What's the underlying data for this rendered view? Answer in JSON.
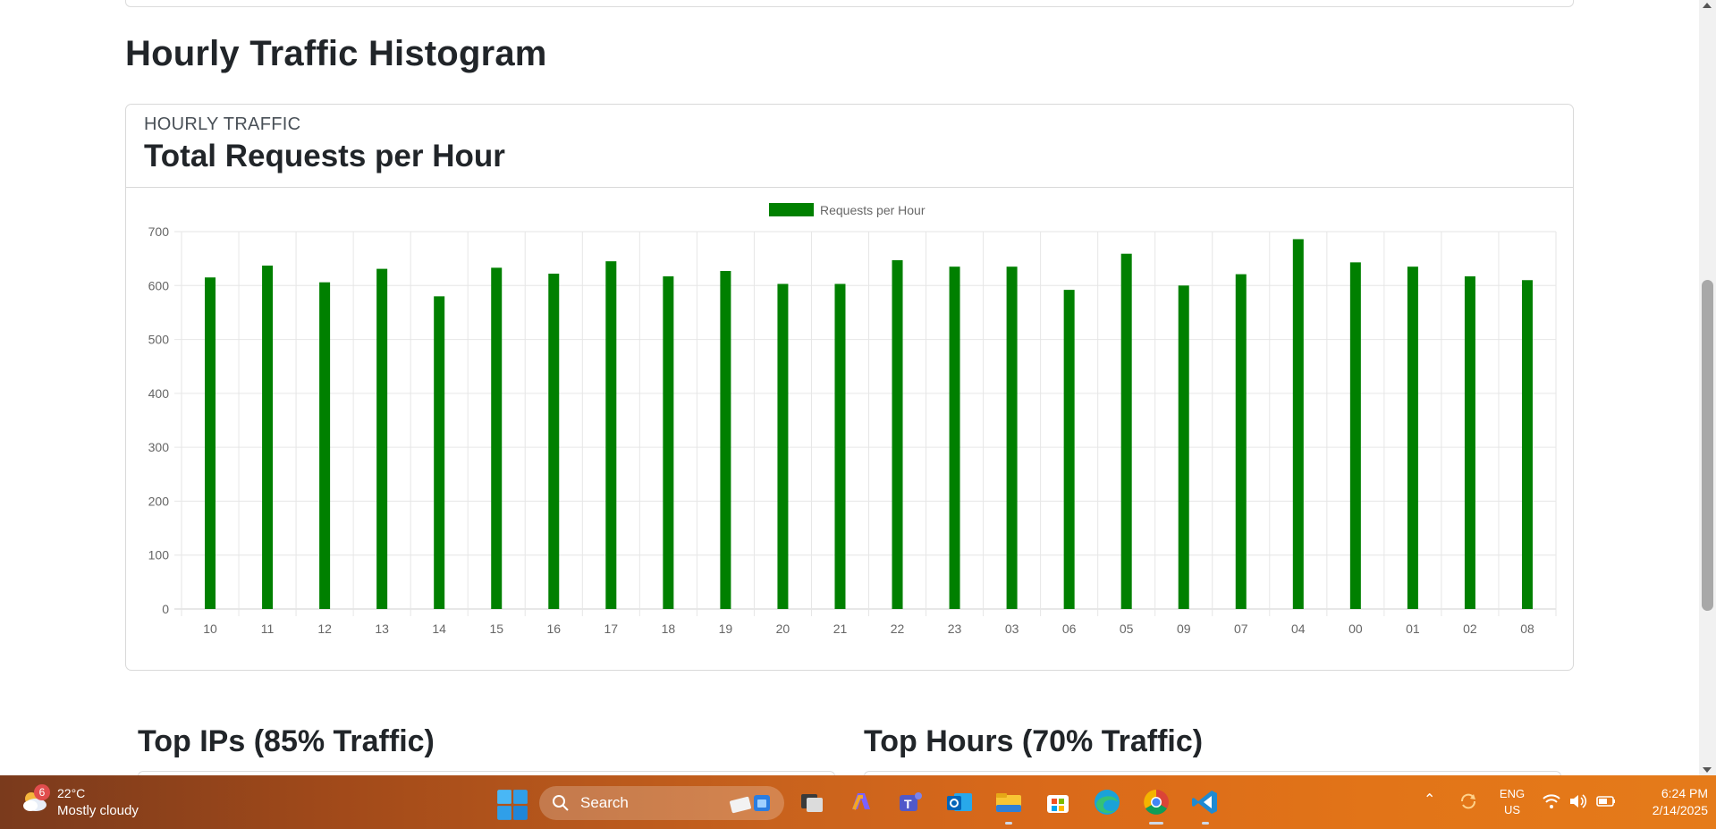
{
  "page": {
    "section_title": "Hourly Traffic Histogram",
    "card_subtitle": "HOURLY TRAFFIC",
    "card_title": "Total Requests per Hour",
    "bottom_left_title": "Top IPs (85% Traffic)",
    "bottom_right_title": "Top Hours (70% Traffic)"
  },
  "chart_data": {
    "type": "bar",
    "categories": [
      "10",
      "11",
      "12",
      "13",
      "14",
      "15",
      "16",
      "17",
      "18",
      "19",
      "20",
      "21",
      "22",
      "23",
      "03",
      "06",
      "05",
      "09",
      "07",
      "04",
      "00",
      "01",
      "02",
      "08"
    ],
    "series": [
      {
        "name": "Requests per Hour",
        "color": "#008000",
        "values": [
          615,
          637,
          606,
          631,
          580,
          633,
          622,
          645,
          617,
          627,
          603,
          603,
          647,
          635,
          635,
          592,
          659,
          600,
          621,
          686,
          643,
          635,
          617,
          610
        ]
      }
    ],
    "ylim": [
      0,
      700
    ],
    "yticks": [
      0,
      100,
      200,
      300,
      400,
      500,
      600,
      700
    ],
    "grid": true,
    "legend": "top-center"
  },
  "taskbar": {
    "weather": {
      "badge": "6",
      "temp": "22°C",
      "desc": "Mostly cloudy"
    },
    "search_label": "Search",
    "language": {
      "line1": "ENG",
      "line2": "US"
    },
    "clock": {
      "time": "6:24 PM",
      "date": "2/14/2025"
    },
    "apps": [
      "start-icon",
      "task-view-icon",
      "copilot-icon",
      "teams-icon",
      "outlook-icon",
      "file-explorer-icon",
      "store-icon",
      "edge-icon",
      "chrome-icon",
      "vscode-icon"
    ]
  }
}
